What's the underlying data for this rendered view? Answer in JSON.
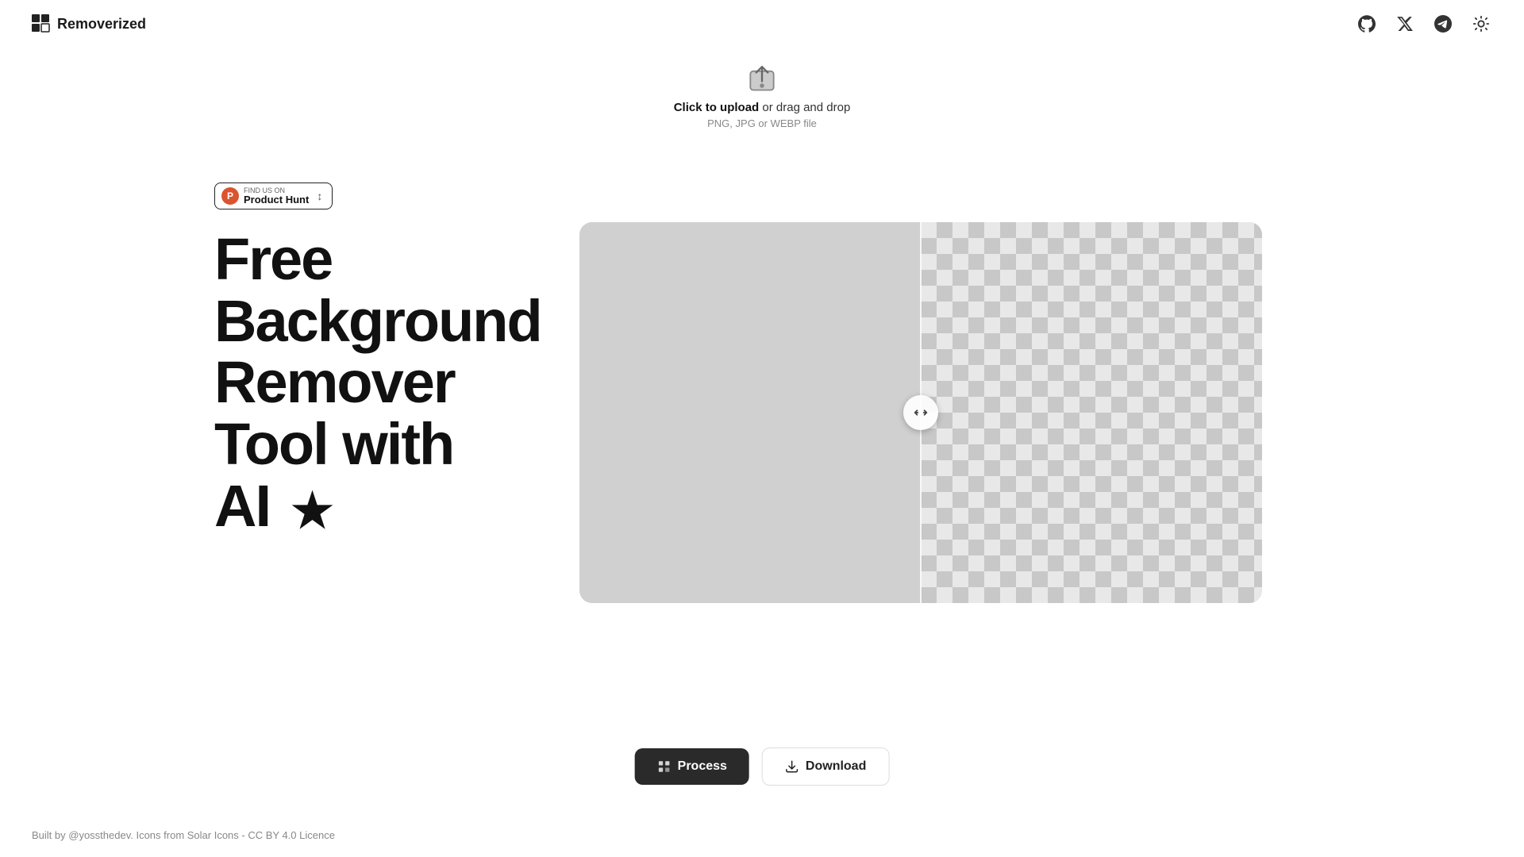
{
  "header": {
    "logo_text": "Removerized",
    "icons": {
      "github": "github-icon",
      "twitter": "twitter-x-icon",
      "telegram": "telegram-icon",
      "theme": "theme-toggle-icon"
    }
  },
  "upload": {
    "click_text": "Click to upload",
    "drag_text": " or drag and drop",
    "file_types": "PNG, JPG or WEBP file"
  },
  "badge": {
    "find_us_on": "FIND US ON",
    "name": "Product Hunt",
    "votes": "↕"
  },
  "hero": {
    "title_line1": "Free",
    "title_line2": "Background",
    "title_line3": "Remover",
    "title_line4": "Tool with",
    "title_line5": "AI"
  },
  "buttons": {
    "process": "Process",
    "download": "Download"
  },
  "footer": {
    "text": "Built by @yossthedev. Icons from Solar Icons - CC BY 4.0 Licence"
  }
}
